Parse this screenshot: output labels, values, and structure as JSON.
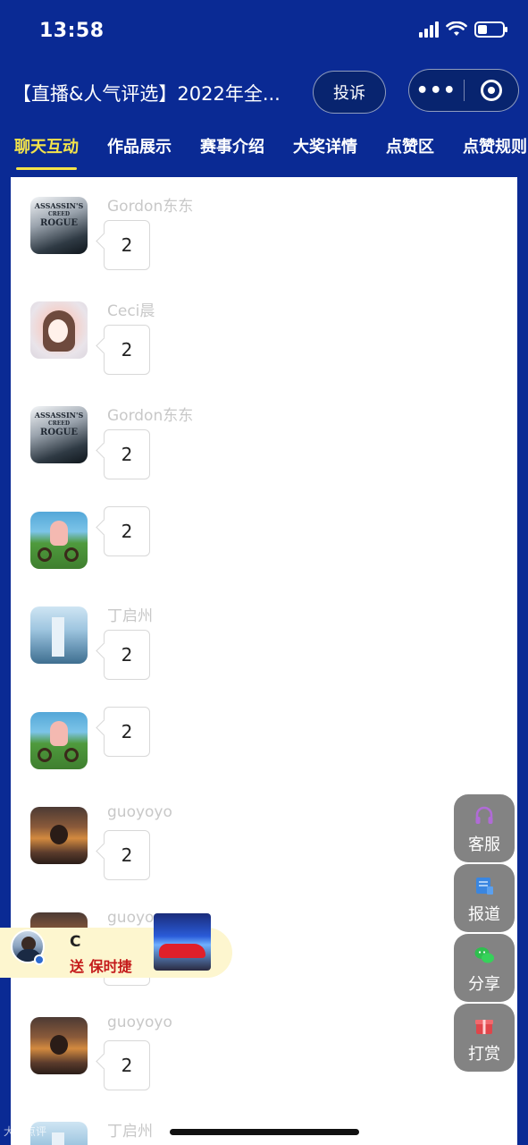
{
  "status_bar": {
    "time": "13:58"
  },
  "title_bar": {
    "title": "【直播&人气评选】2022年全...",
    "complain_label": "投诉",
    "more_label": "•••"
  },
  "tabs": [
    {
      "label": "聊天互动",
      "active": true
    },
    {
      "label": "作品展示",
      "active": false
    },
    {
      "label": "赛事介绍",
      "active": false
    },
    {
      "label": "大奖详情",
      "active": false
    },
    {
      "label": "点赞区",
      "active": false
    },
    {
      "label": "点赞规则",
      "active": false
    }
  ],
  "messages": [
    {
      "nickname": "Gordon东东",
      "text": "2",
      "avatar": "assassins-creed"
    },
    {
      "nickname": "Ceci晨",
      "text": "2",
      "avatar": "girl-portrait"
    },
    {
      "nickname": "Gordon东东",
      "text": "2",
      "avatar": "assassins-creed"
    },
    {
      "nickname": "",
      "text": "2",
      "avatar": "bike-cartoon"
    },
    {
      "nickname": "丁启州",
      "text": "2",
      "avatar": "city-tower"
    },
    {
      "nickname": "",
      "text": "2",
      "avatar": "bike-cartoon"
    },
    {
      "nickname": "guoyoyo",
      "text": "2",
      "avatar": "sunset-person"
    },
    {
      "nickname": "guoyo",
      "text": "",
      "avatar": "sunset-person"
    },
    {
      "nickname": "guoyoyo",
      "text": "2",
      "avatar": "sunset-person"
    },
    {
      "nickname": "丁启州",
      "text": "",
      "avatar": "city-tower"
    }
  ],
  "avatar_text": {
    "line1": "ASSASSIN'S",
    "line2": "CREED",
    "line3": "ROGUE"
  },
  "floating_buttons": [
    {
      "label": "客服",
      "icon": "headset-icon",
      "color": "#b06bd6"
    },
    {
      "label": "报道",
      "icon": "news-icon",
      "color": "#3a86e0"
    },
    {
      "label": "分享",
      "icon": "wechat-icon",
      "color": "#2fbf4f"
    },
    {
      "label": "打赏",
      "icon": "gift-icon",
      "color": "#e0454a"
    }
  ],
  "gift_notice": {
    "user": "C",
    "text": "送 保时捷"
  },
  "watermark": "大众点评"
}
